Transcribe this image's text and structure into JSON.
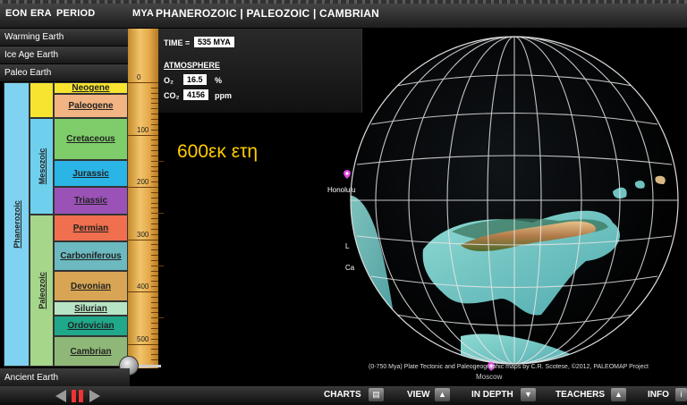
{
  "header": {
    "eon": "EON",
    "era": "ERA",
    "period": "PERIOD",
    "mya": "MYA",
    "breadcrumb": "PHANEROZOIC | PALEOZOIC | CAMBRIAN"
  },
  "menu": {
    "warming": "Warming Earth",
    "ice_age": "Ice Age Earth",
    "paleo": "Paleo Earth",
    "ancient": "Ancient Earth"
  },
  "timeline": {
    "eon": "Phanerozoic",
    "eras": [
      "Mesozoic",
      "Paleozoic"
    ],
    "periods": [
      "Neogene",
      "Paleogene",
      "Cretaceous",
      "Jurassic",
      "Triassic",
      "Permian",
      "Carboniferous",
      "Devonian",
      "Silurian",
      "Ordovician",
      "Cambrian"
    ],
    "ruler_labels": [
      "0",
      "100",
      "200",
      "300",
      "400",
      "500"
    ]
  },
  "info": {
    "time_label": "TIME =",
    "time_value": "535 MYA",
    "atmosphere_label": "ATMOSPHERE",
    "o2_label": "O₂",
    "o2_value": "16.5",
    "o2_unit": "%",
    "co2_label": "CO₂",
    "co2_value": "4156",
    "co2_unit": "ppm"
  },
  "overlay_text": "600εκ ετη",
  "globe": {
    "honolulu": "Honolulu",
    "label_l": "L",
    "label_ca": "Ca",
    "moscow": "Moscow",
    "credits": "(0-750 Mya) Plate Tectonic and Paleogeographic maps by C.R. Scotese, ©2012, PALEOMAP Project"
  },
  "bottombar": {
    "charts": "CHARTS",
    "view": "VIEW",
    "indepth": "IN DEPTH",
    "teachers": "TEACHERS",
    "info": "INFO"
  },
  "colors": {
    "neogene": "#f6e430",
    "paleogene": "#f3b484",
    "cretaceous": "#7ecd6a",
    "jurassic": "#2bb5e6",
    "triassic": "#9a52b6",
    "permian": "#ef6f4e",
    "carboniferous": "#6cb9bf",
    "devonian": "#d8a554",
    "silurian": "#b7e4c4",
    "ordovician": "#1fa88a",
    "cambrian": "#8fb878",
    "mesozoic": "#6fd0ee",
    "paleozoic": "#a6d68a",
    "phanerozoic": "#7fd3f0"
  }
}
